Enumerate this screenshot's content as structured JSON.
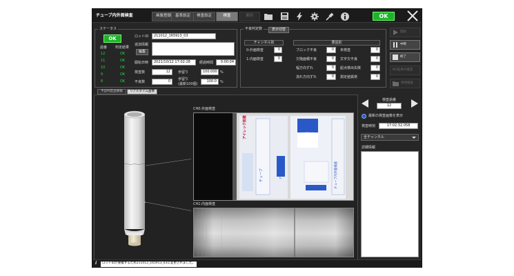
{
  "app": {
    "title": "チューブ内外面検査"
  },
  "tabs": [
    {
      "label": "画像登録"
    },
    {
      "label": "基準設定"
    },
    {
      "label": "検査設定"
    },
    {
      "label": "検査"
    },
    {
      "label": "解析"
    }
  ],
  "toolbar": {
    "ok_label": "OK"
  },
  "status_group": {
    "title": "ステータス",
    "ok_label": "OK",
    "history_header": {
      "count": "過番",
      "result": "判定結果"
    },
    "history": [
      {
        "count": "12",
        "result": "OK"
      },
      {
        "count": "11",
        "result": "OK"
      },
      {
        "count": "10",
        "result": "OK"
      },
      {
        "count": "9",
        "result": "OK"
      },
      {
        "count": "8",
        "result": "OK"
      }
    ],
    "lot_id_label": "ロットID",
    "lot_id_value": "211012_165913_03",
    "extra_info_label": "追加情報",
    "edit_button": "編集",
    "start_time_label": "開始日時",
    "start_time_value": "2021/10/12 17:02:28",
    "elapsed_label": "経過時間",
    "elapsed_value": "0:00:04",
    "inspect_count_label": "検査数",
    "inspect_count_value": "12",
    "yield_label": "歩留り",
    "yield_value": "100.000",
    "yield_unit": "%",
    "defect_count_label": "不良数",
    "defect_count_value": "0",
    "yield_recent_label_1": "歩留り",
    "yield_recent_label_2": "(最新100個)",
    "yield_recent_value": "100.0",
    "yield_recent_unit": "%"
  },
  "defect_group": {
    "title": "不良判定数",
    "toggle_button": "表示切替",
    "channel_header": "チャンネル別",
    "type_header": "要因別",
    "channels": [
      {
        "label": "0:外面検査",
        "value": "0"
      },
      {
        "label": "1:内面検査",
        "value": "0"
      }
    ],
    "types_left": [
      {
        "label": "ブロック不良",
        "value": "0"
      },
      {
        "label": "欠陥面積不良",
        "value": "0"
      },
      {
        "label": "幅方向ずれ",
        "value": "0"
      },
      {
        "label": "流れ方向ずれ",
        "value": "0"
      }
    ],
    "types_right": [
      {
        "label": "未検査",
        "value": "0"
      },
      {
        "label": "文字欠不良",
        "value": "0"
      },
      {
        "label": "起点検出失敗",
        "value": "0"
      },
      {
        "label": "測定値異常",
        "value": "0"
      }
    ]
  },
  "side_buttons": [
    {
      "label": "開始"
    },
    {
      "label": "中断"
    },
    {
      "label": "終了"
    },
    {
      "label": "NG結果の確認"
    },
    {
      "label": "目視検査"
    }
  ],
  "subtabs": [
    {
      "label": "不良判定品情報"
    },
    {
      "label": "リアルタイム画像"
    }
  ],
  "viewer": {
    "ch0_title": "CH0:外面検査",
    "ch1_title": "CH1:内面検査",
    "print_text_1": "チューブ",
    "print_text_2": "内外面検査",
    "print_text_3": "アイレック技建",
    "print_text_4": "チューブ内外面検査",
    "print_text_5": "アイレック技建"
  },
  "right_panel": {
    "inspection_no_label": "検査過番",
    "inspection_no_value": "12",
    "latest_image_label": "最新の検査画像を表示",
    "inspect_time_label": "検査時刻",
    "inspect_time_value": "17:02:32.058",
    "channel_select": "全チャンネル",
    "detail_label": "詳細情報"
  },
  "statusbar": {
    "message": "ロットIDが重複するため211012_165913_03に変更されました。"
  },
  "colors": {
    "ok_green": "#1fb32a",
    "accent_blue": "#2a58c8",
    "background": "#262626"
  }
}
